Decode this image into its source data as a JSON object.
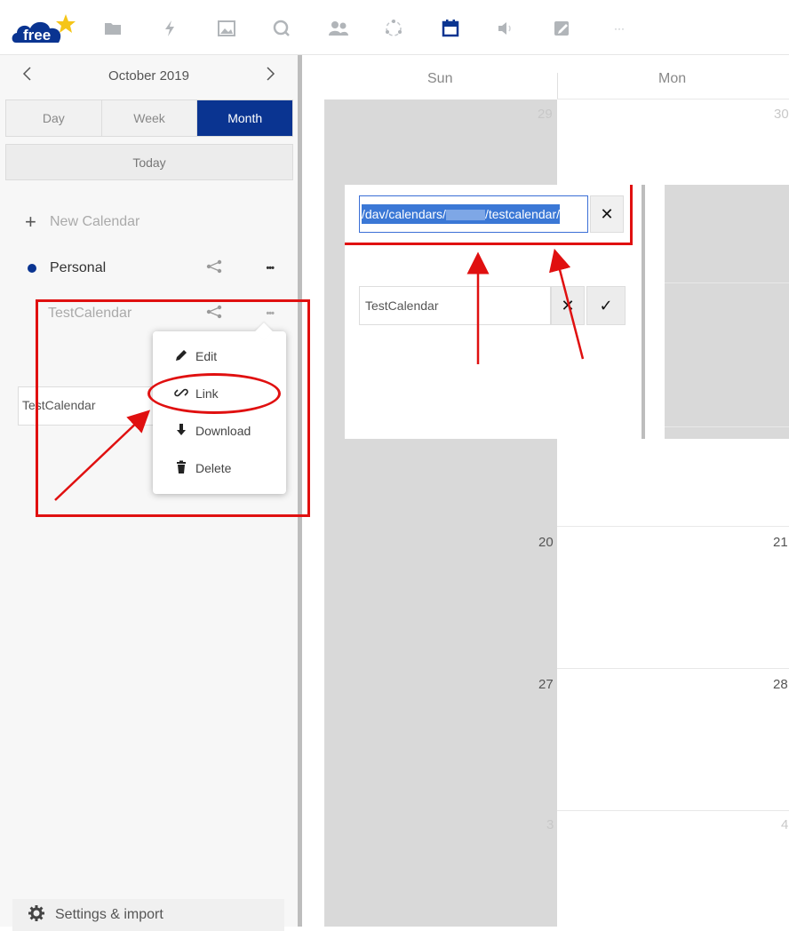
{
  "header": {
    "logo_text": "free",
    "apps": [
      {
        "icon": "folder-icon",
        "glyph": "▮"
      },
      {
        "icon": "activity-icon",
        "glyph": "ϟ"
      },
      {
        "icon": "gallery-icon",
        "glyph": "▨"
      },
      {
        "icon": "search-icon",
        "glyph": "◯"
      },
      {
        "icon": "contacts-icon",
        "glyph": "👥"
      },
      {
        "icon": "circles-icon",
        "glyph": "◌"
      },
      {
        "icon": "calendar-icon",
        "glyph": "▣"
      },
      {
        "icon": "announcement-icon",
        "glyph": "◀"
      },
      {
        "icon": "notes-icon",
        "glyph": "✎"
      },
      {
        "icon": "more-apps-icon",
        "glyph": "···"
      }
    ],
    "active_app_color": "#0a3491"
  },
  "sidebar": {
    "month_label": "October 2019",
    "prev_glyph": "‹",
    "next_glyph": "›",
    "views": {
      "day": "Day",
      "week": "Week",
      "month": "Month"
    },
    "today": "Today",
    "new_calendar": "New Calendar",
    "new_calendar_glyph": "+",
    "calendars": {
      "personal": {
        "label": "Personal",
        "color": "#0a3491"
      },
      "test": {
        "label": "TestCalendar"
      }
    },
    "share_glyph": "<",
    "more_glyph": "•••",
    "rename_value": "TestCalendar",
    "menu": {
      "edit": "Edit",
      "link": "Link",
      "download": "Download",
      "delete": "Delete"
    },
    "settings": "Settings & import"
  },
  "grid": {
    "day_headers": {
      "sun": "Sun",
      "mon": "Mon"
    },
    "dates": {
      "r1_sun": "29",
      "r1_mon": "30",
      "r4_sun": "20",
      "r4_mon": "21",
      "r5_sun": "27",
      "r5_mon": "28",
      "r6_sun": "3",
      "r6_mon": "4"
    }
  },
  "inset": {
    "url_value": "/dav/calendars/        /testcalendar/",
    "url_prefix": "/dav/calendars/",
    "url_suffix": "/testcalendar/",
    "close_glyph": "✕",
    "rename_value": "TestCalendar",
    "confirm_glyph": "✓"
  },
  "annotation_color": "#e01010"
}
